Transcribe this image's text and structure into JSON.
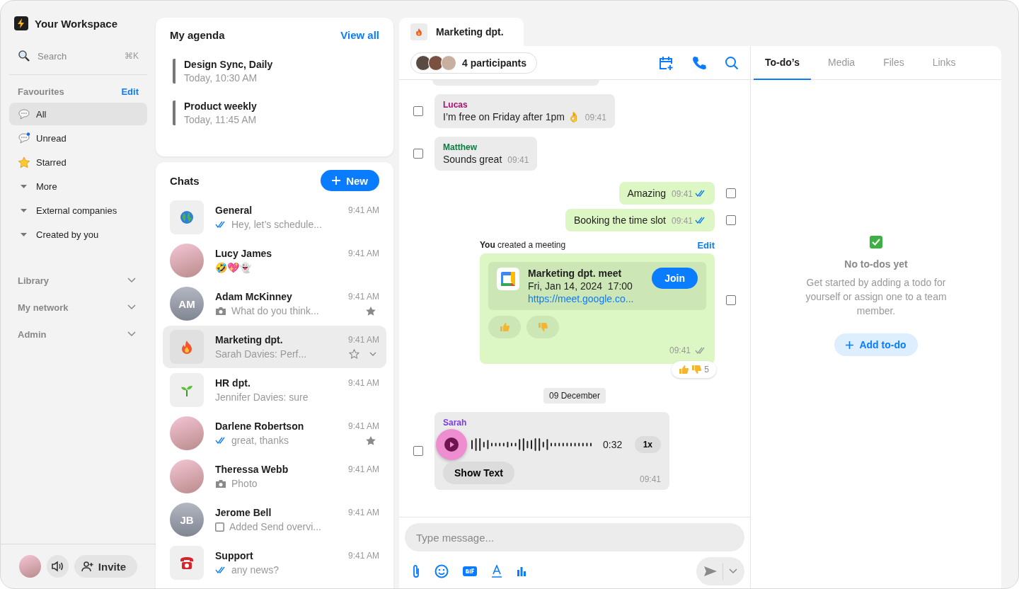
{
  "sidebar": {
    "workspace": "Your Workspace",
    "search": {
      "placeholder": "Search",
      "shortcut": "⌘K"
    },
    "favourites": {
      "title": "Favourites",
      "action": "Edit",
      "items": [
        {
          "label": "All",
          "kind": "chat",
          "selected": true
        },
        {
          "label": "Unread",
          "kind": "unread",
          "selected": false
        },
        {
          "label": "Starred",
          "kind": "star",
          "selected": false
        },
        {
          "label": "More",
          "kind": "folder",
          "selected": false
        },
        {
          "label": "External companies",
          "kind": "folder",
          "selected": false
        },
        {
          "label": "Created by you",
          "kind": "folder",
          "selected": false
        }
      ]
    },
    "sections": [
      {
        "label": "Library",
        "expanded": false
      },
      {
        "label": "My network",
        "expanded": false
      },
      {
        "label": "Admin",
        "expanded": false
      }
    ],
    "footer": {
      "invite": "Invite"
    }
  },
  "agenda": {
    "title": "My agenda",
    "action": "View all",
    "events": [
      {
        "title": "Design Sync, Daily",
        "time": "Today, 10:30 AM"
      },
      {
        "title": "Product weekly",
        "time": "Today, 11:45 AM"
      }
    ]
  },
  "chats": {
    "title": "Chats",
    "action": "New",
    "items": [
      {
        "name": "General",
        "avatar": {
          "kind": "globe"
        },
        "marker": {
          "kind": "read"
        },
        "preview": "Hey, let’s schedule...",
        "time": "9:41 AM",
        "starred": false,
        "selected": false
      },
      {
        "name": "Lucy James",
        "avatar": {
          "kind": "photo"
        },
        "preview": "🤣💖👻",
        "time": "9:41 AM",
        "starred": false,
        "selected": false
      },
      {
        "name": "Adam McKinney",
        "avatar": {
          "kind": "initials",
          "initials": "AM"
        },
        "marker": {
          "kind": "camera"
        },
        "preview": "What do you think...",
        "time": "9:41 AM",
        "starred": true,
        "selected": false
      },
      {
        "name": "Marketing dpt.",
        "avatar": {
          "kind": "fire"
        },
        "preview": "Sarah Davies:  Perf...",
        "time": "9:41 AM",
        "starred": false,
        "selected": true
      },
      {
        "name": "HR dpt.",
        "avatar": {
          "kind": "sprout"
        },
        "preview": "Jennifer Davies:  sure",
        "time": "9:41 AM",
        "starred": false,
        "selected": false
      },
      {
        "name": "Darlene Robertson",
        "avatar": {
          "kind": "photo"
        },
        "marker": {
          "kind": "read"
        },
        "preview": "great, thanks",
        "time": "9:41 AM",
        "starred": true,
        "selected": false
      },
      {
        "name": "Theressa Webb",
        "avatar": {
          "kind": "photo"
        },
        "marker": {
          "kind": "camera"
        },
        "preview": "Photo",
        "time": "9:41 AM",
        "starred": false,
        "selected": false
      },
      {
        "name": "Jerome Bell",
        "avatar": {
          "kind": "initials",
          "initials": "JB"
        },
        "marker": {
          "kind": "task"
        },
        "preview": "Added Send overvi...",
        "time": "9:41 AM",
        "starred": false,
        "selected": false
      },
      {
        "name": "Support",
        "avatar": {
          "kind": "telephone"
        },
        "marker": {
          "kind": "read"
        },
        "preview": "any news?",
        "time": "9:41 AM",
        "starred": false,
        "selected": false
      }
    ]
  },
  "conversation": {
    "tab": {
      "title": "Marketing dpt.",
      "avatar": {
        "kind": "fire"
      }
    },
    "participants": "4 participants",
    "messages": [
      {
        "kind": "incoming",
        "sender": "Lucas",
        "color": "#a3126f",
        "text": "I’m free on Friday after 1pm 👌",
        "time": "09:41",
        "checked": false
      },
      {
        "kind": "incoming",
        "sender": "Matthew",
        "color": "#0e7a3f",
        "text": "Sounds great",
        "time": "09:41",
        "checked": false
      },
      {
        "kind": "outgoing",
        "text": "Amazing",
        "time": "09:41",
        "read": true,
        "checked": false
      },
      {
        "kind": "outgoing",
        "text": "Booking the time slot",
        "time": "09:41",
        "read": true,
        "checked": false
      },
      {
        "kind": "meeting",
        "caption": "**You** created a meeting",
        "action": "Edit",
        "title": "Marketing dpt. meet",
        "when": "Fri, Jan 14, 2024  17:00",
        "link": "https://meet.google.co...",
        "join": "Join",
        "time": "09:41",
        "read": false,
        "reaction_count": "5",
        "checked": false
      },
      {
        "kind": "date",
        "text": "09 December"
      },
      {
        "kind": "voice",
        "sender": "Sarah",
        "color": "#7c3aed",
        "duration": "0:32",
        "speed": "1x",
        "action": "Show Text",
        "time": "09:41",
        "checked": false
      }
    ],
    "composer": {
      "placeholder": "Type message..."
    }
  },
  "details": {
    "tabs": [
      {
        "label": "To-do’s",
        "selected": true
      },
      {
        "label": "Media",
        "selected": false
      },
      {
        "label": "Files",
        "selected": false
      },
      {
        "label": "Links",
        "selected": false
      }
    ],
    "empty": {
      "title": "No to-dos yet",
      "text": "Get started by adding a todo for yourself or assign one to a team member.",
      "action": "Add to-do"
    }
  }
}
